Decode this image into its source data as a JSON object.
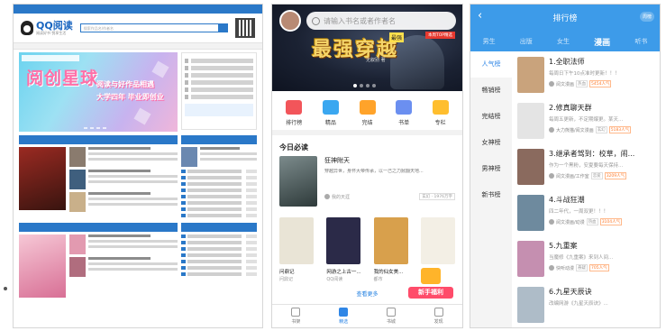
{
  "desktop": {
    "logo_text": "QQ阅读",
    "logo_sub": "阅读好书 悦享生活",
    "search_placeholder": "搜索作品名/作者名",
    "banner_big": "阅创星球",
    "banner_mid1": "阅读与好作品相遇",
    "banner_mid2": "大学四年 毕业即创业"
  },
  "mobile_home": {
    "search_placeholder": "请输入书名或者作者名",
    "badge": "本周TOP精选",
    "banner_title": "最强穿越",
    "banner_chip": "最强",
    "banner_author": "无叙别 著",
    "categories": [
      {
        "label": "排行榜",
        "color": "#f2555a"
      },
      {
        "label": "精品",
        "color": "#3aa7f0"
      },
      {
        "label": "完结",
        "color": "#ffa32a"
      },
      {
        "label": "书单",
        "color": "#6b8ff0"
      },
      {
        "label": "专栏",
        "color": "#ffbe2e"
      }
    ],
    "section_title": "今日必读",
    "featured": {
      "name": "狂神附天",
      "desc": "穿越异世，身怀大帝传承，以一己之力掀翻天地...",
      "author": "我的天涯",
      "tag": "玄幻 · 1976万字"
    },
    "books": [
      {
        "name": "问鼎记",
        "author": "问鼎记",
        "color": "#e9e4d6"
      },
      {
        "name": "网游之上古一...",
        "author": "QQ阅读",
        "color": "#2b2a48"
      },
      {
        "name": "我的仙女美...",
        "author": "都市",
        "color": "#d8a04c"
      },
      {
        "name": "新手福利",
        "author": "",
        "color": "#f3efe5"
      }
    ],
    "more": "查看更多",
    "gift": "新手福利",
    "tabs": [
      {
        "label": "书架",
        "on": false
      },
      {
        "label": "精选",
        "on": true
      },
      {
        "label": "书城",
        "on": false
      },
      {
        "label": "发现",
        "on": false
      }
    ]
  },
  "ranking": {
    "title": "排行榜",
    "week": "周榜",
    "tabs": [
      {
        "label": "男生",
        "on": false
      },
      {
        "label": "出版",
        "on": false
      },
      {
        "label": "女生",
        "on": false
      },
      {
        "label": "漫画",
        "on": true
      },
      {
        "label": "听书",
        "on": false
      }
    ],
    "side": [
      {
        "label": "人气榜",
        "on": true
      },
      {
        "label": "畅销榜",
        "on": false
      },
      {
        "label": "完结榜",
        "on": false
      },
      {
        "label": "女神榜",
        "on": false
      },
      {
        "label": "男神榜",
        "on": false
      },
      {
        "label": "新书榜",
        "on": false
      }
    ],
    "items": [
      {
        "title": "1.全职法师",
        "desc": "每周日下午10点准时更新！！！",
        "author": "阅文漫画",
        "genre": "热血",
        "pop": "5454人气",
        "color": "#c9a37c"
      },
      {
        "title": "2.修真聊天群",
        "desc": "每周五更新，不定期爆更。某天...",
        "author": "大力熊猫/阅文漫画",
        "genre": "玄幻",
        "pop": "5183人气",
        "color": "#e4e4e4"
      },
      {
        "title": "3.继承者驾到：校草，闹...",
        "desc": "作为一个黑粉，安夏要每天保持...",
        "author": "阅文漫画/工作室",
        "genre": "恋爱",
        "pop": "3209人气",
        "color": "#8a6a5e"
      },
      {
        "title": "4.斗战狂潮",
        "desc": "四二年代，一周双更！！！",
        "author": "阅文漫画/动漫",
        "genre": "热血",
        "pop": "3104人气",
        "color": "#6e8a9e"
      },
      {
        "title": "5.九重案",
        "desc": "当魔修《九重案》来到人间...",
        "author": "快听动漫",
        "genre": "悬疑",
        "pop": "705人气",
        "color": "#c58fb0"
      },
      {
        "title": "6.九星天辰诀",
        "desc": "改编网游《九星天辰诀》...",
        "author": "",
        "genre": "",
        "pop": "",
        "color": "#aebcc8"
      }
    ]
  }
}
